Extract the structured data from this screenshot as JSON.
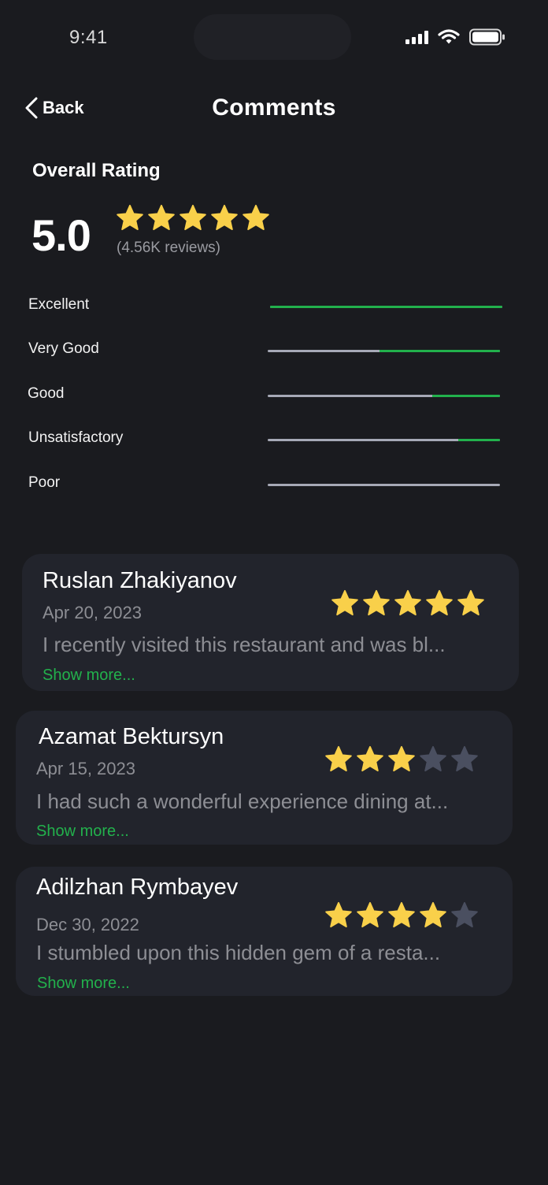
{
  "status_bar": {
    "time": "9:41"
  },
  "header": {
    "back_label": "Back",
    "title": "Comments"
  },
  "overall": {
    "title": "Overall Rating",
    "score": "5.0",
    "stars": 5,
    "reviews": "(4.56K reviews)"
  },
  "breakdown": [
    {
      "label": "Excellent",
      "fraction": 1.0
    },
    {
      "label": "Very Good",
      "fraction": 0.52
    },
    {
      "label": "Good",
      "fraction": 0.29
    },
    {
      "label": "Unsatisfactory",
      "fraction": 0.18
    },
    {
      "label": "Poor",
      "fraction": 0.0
    }
  ],
  "reviews": [
    {
      "name": "Ruslan Zhakiyanov",
      "date": "Apr 20, 2023",
      "rating": 5,
      "text": "I recently visited this restaurant and was bl...",
      "show_more": "Show more..."
    },
    {
      "name": "Azamat Bektursyn",
      "date": "Apr 15, 2023",
      "rating": 3,
      "text": "I had such a wonderful experience dining at...",
      "show_more": "Show more..."
    },
    {
      "name": "Adilzhan Rymbayev",
      "date": "Dec 30, 2022",
      "rating": 4,
      "text": "I stumbled upon this hidden gem of a resta...",
      "show_more": "Show more..."
    }
  ],
  "colors": {
    "background": "#1a1b1f",
    "card": "#22242c",
    "accent_green": "#22b14c",
    "star_filled": "#f9d04a",
    "star_empty": "#4a4f60",
    "muted_text": "#8d8e94"
  }
}
